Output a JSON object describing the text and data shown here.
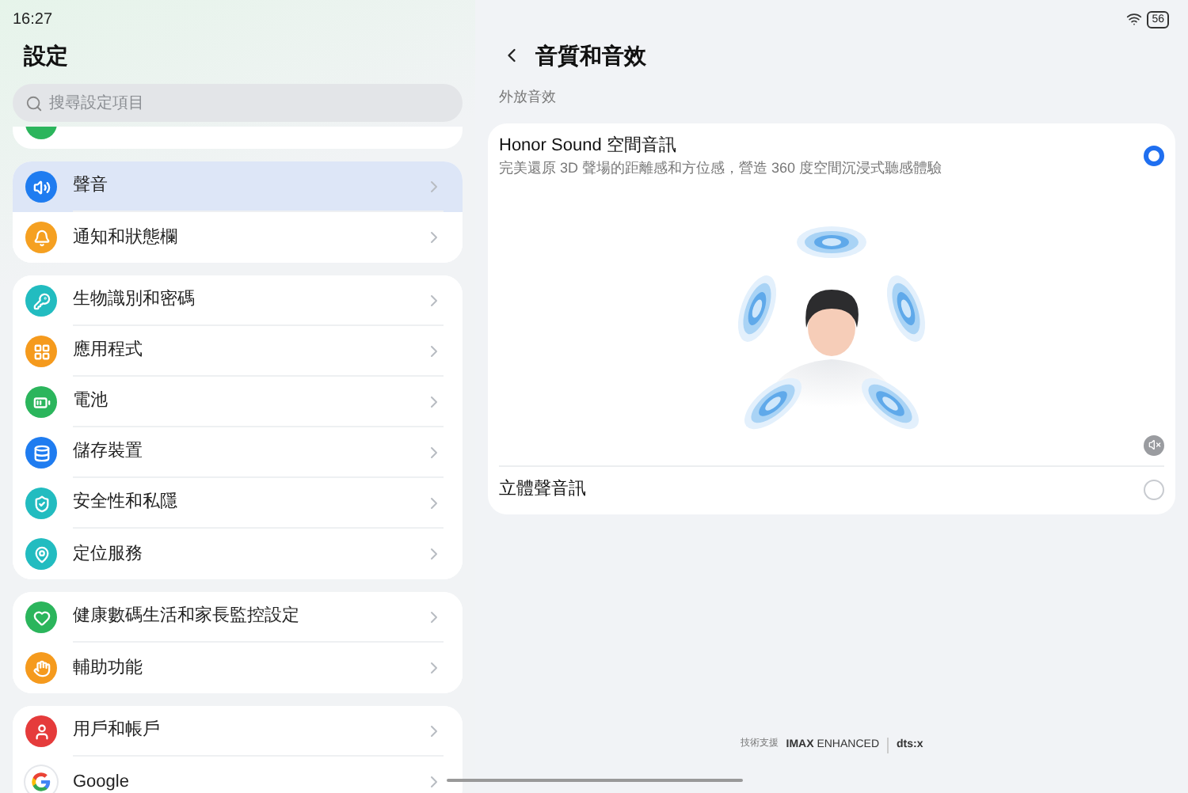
{
  "status_bar": {
    "time": "16:27",
    "battery": "56"
  },
  "sidebar": {
    "title": "設定",
    "search": {
      "placeholder": "搜尋設定項目"
    },
    "clipped_item": {
      "color": "#2bb55c"
    },
    "groups": [
      {
        "items": [
          {
            "label": "聲音",
            "color": "#1f7cf0",
            "selected": true
          },
          {
            "label": "通知和狀態欄",
            "color": "#f5a021",
            "selected": false
          }
        ]
      },
      {
        "items": [
          {
            "label": "生物識別和密碼",
            "color": "#22bcc0",
            "selected": false
          },
          {
            "label": "應用程式",
            "color": "#f59a1d",
            "selected": false
          },
          {
            "label": "電池",
            "color": "#2bb55c",
            "selected": false
          },
          {
            "label": "儲存裝置",
            "color": "#1f7cf0",
            "selected": false
          },
          {
            "label": "安全性和私隱",
            "color": "#22bcc0",
            "selected": false
          },
          {
            "label": "定位服務",
            "color": "#22bcc0",
            "selected": false
          }
        ]
      },
      {
        "items": [
          {
            "label": "健康數碼生活和家長監控設定",
            "color": "#2bb55c",
            "selected": false
          },
          {
            "label": "輔助功能",
            "color": "#f59a1d",
            "selected": false
          }
        ]
      },
      {
        "items": [
          {
            "label": "用戶和帳戶",
            "color": "#e53b3b",
            "selected": false
          },
          {
            "label": "Google",
            "color": "#ffffff",
            "selected": false
          }
        ]
      }
    ]
  },
  "page": {
    "title": "音質和音效",
    "section": "外放音效",
    "options": [
      {
        "kind": "spatial",
        "title": "Honor Sound 空間音訊",
        "subtitle": "完美還原 3D 聲場的距離感和方位感，營造 360 度空間沉浸式聽感體驗",
        "selected": true
      },
      {
        "kind": "plain",
        "title": "立體聲音訊",
        "selected": false
      }
    ],
    "footer": {
      "prefix": "技術支援",
      "brands": [
        "**IMAX** ENHANCED",
        "dts:x"
      ]
    }
  }
}
